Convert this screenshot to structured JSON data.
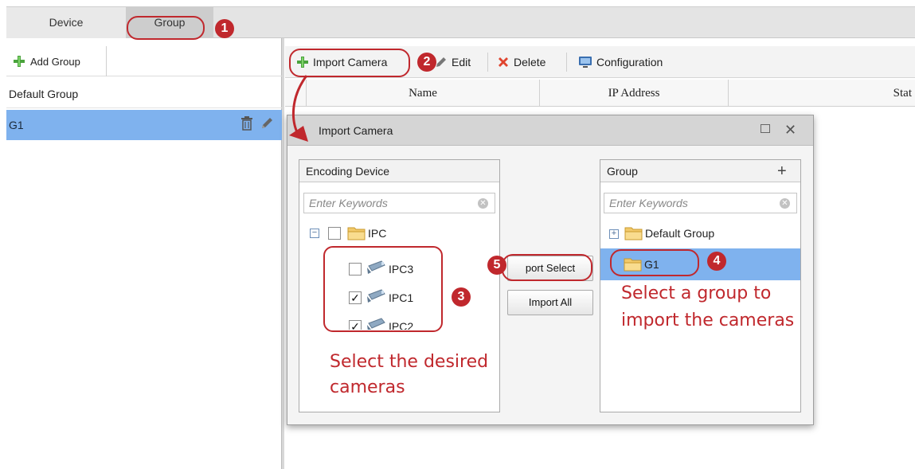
{
  "tabs": [
    {
      "label": "Device",
      "active": false
    },
    {
      "label": "Group",
      "active": true
    }
  ],
  "left_panel": {
    "add_group_label": "Add Group",
    "groups": [
      {
        "label": "Default Group",
        "selected": false
      },
      {
        "label": "G1",
        "selected": true
      }
    ]
  },
  "toolbar": {
    "import_camera": "Import Camera",
    "edit": "Edit",
    "delete": "Delete",
    "configuration": "Configuration"
  },
  "table": {
    "columns": [
      "Name",
      "IP Address",
      "Stat"
    ]
  },
  "dialog": {
    "title": "Import Camera",
    "left_pane": {
      "title": "Encoding Device",
      "search_placeholder": "Enter Keywords",
      "root": {
        "label": "IPC",
        "expanded": true,
        "checked": false
      },
      "cameras": [
        {
          "label": "IPC3",
          "checked": false
        },
        {
          "label": "IPC1",
          "checked": true
        },
        {
          "label": "IPC2",
          "checked": true
        }
      ]
    },
    "buttons": {
      "import_selected": "port Select",
      "import_all": "Import All"
    },
    "right_pane": {
      "title": "Group",
      "add_symbol": "+",
      "search_placeholder": "Enter Keywords",
      "nodes": [
        {
          "label": "Default Group",
          "expanded": false
        },
        {
          "label": "G1",
          "selected": true
        }
      ]
    }
  },
  "annotations": {
    "badges": [
      "1",
      "2",
      "3",
      "4",
      "5"
    ],
    "note_cameras": [
      "Select the desired",
      "cameras"
    ],
    "note_group": [
      "Select a group to",
      "import the cameras"
    ],
    "color": "#c0282d"
  },
  "colors": {
    "selected_row": "#7fb2ee",
    "tab_active": "#cdcdcd",
    "title_bar": "#d5d5d5"
  }
}
